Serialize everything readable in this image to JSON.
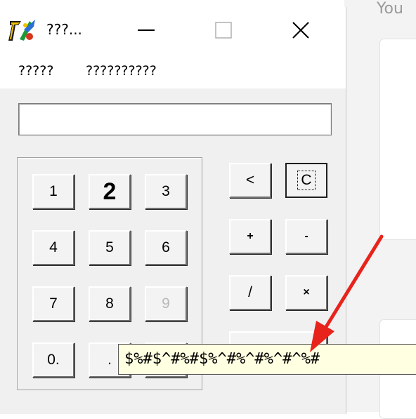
{
  "background_app": {
    "partial_text": "You"
  },
  "window": {
    "title": "???...",
    "controls": {
      "minimize": "minimize",
      "maximize": "maximize",
      "close": "close"
    }
  },
  "menu": {
    "items": [
      "?????",
      "??????????"
    ]
  },
  "display": {
    "value": ""
  },
  "numpad": {
    "rows": [
      [
        "1",
        "2",
        "3"
      ],
      [
        "4",
        "5",
        "6"
      ],
      [
        "7",
        "8",
        "9"
      ],
      [
        "0.",
        ".",
        ""
      ]
    ]
  },
  "operators": {
    "backspace": "<",
    "clear": "C",
    "plus": "+",
    "minus": "-",
    "divide": "/",
    "multiply": "×"
  },
  "tooltip": {
    "text": "$%#$^#%#$%^#%^#%^#^%#"
  },
  "colors": {
    "tooltip_bg": "#ffffe1",
    "arrow": "#e8231c",
    "window_bg": "#f0f0f0"
  },
  "icons": {
    "app": "calculator-logo-icon",
    "annotation": "red-arrow-icon"
  }
}
